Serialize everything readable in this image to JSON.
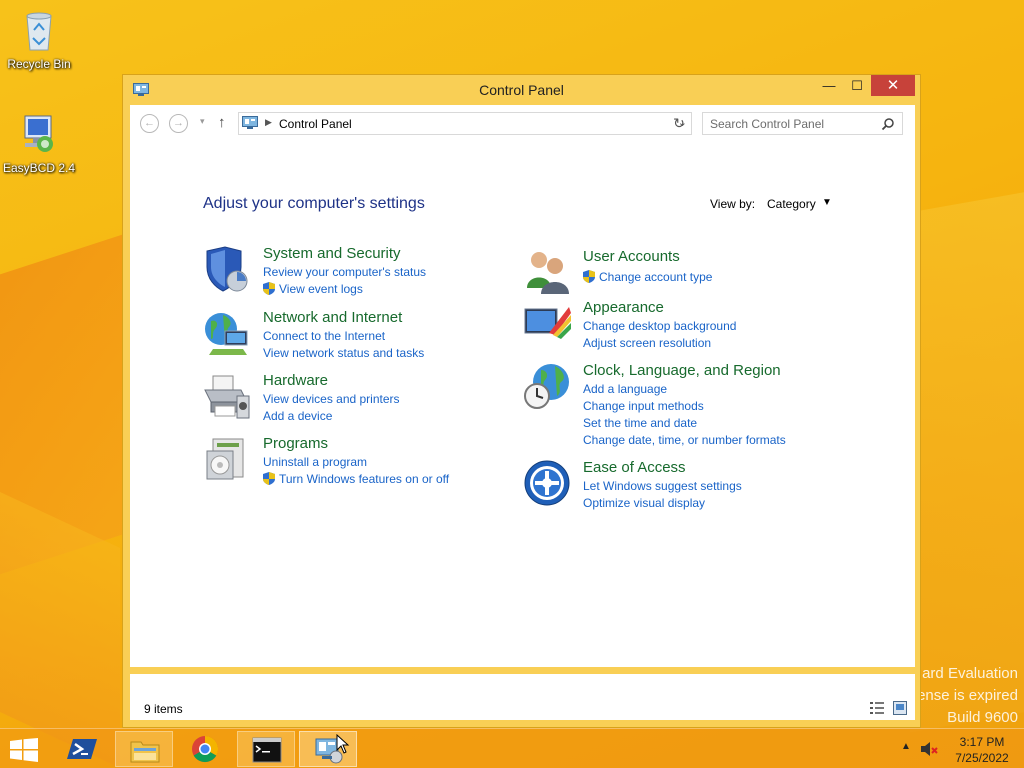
{
  "desktop": {
    "icons": [
      {
        "label": "Recycle Bin",
        "icon": "recycle-bin-icon"
      },
      {
        "label": "EasyBCD 2.4",
        "icon": "easybcd-icon"
      }
    ],
    "watermark": [
      "ard Evaluation",
      "ense is expired",
      "Build 9600"
    ]
  },
  "window": {
    "title": "Control Panel",
    "controls": {
      "minimize": "—",
      "maximize": "☐",
      "close": "✕"
    }
  },
  "nav": {
    "back_icon": "back-arrow-icon",
    "forward_icon": "forward-arrow-icon",
    "up_icon": "up-arrow-icon",
    "address": "Control Panel",
    "search_placeholder": "Search Control Panel"
  },
  "main": {
    "heading": "Adjust your computer's settings",
    "view_by_label": "View by:",
    "view_by_value": "Category",
    "categories_left": [
      {
        "title": "System and Security",
        "icon": "security-shield-icon",
        "links": [
          {
            "text": "Review your computer's status",
            "shield": false
          },
          {
            "text": "View event logs",
            "shield": true
          }
        ]
      },
      {
        "title": "Network and Internet",
        "icon": "network-globe-icon",
        "links": [
          {
            "text": "Connect to the Internet",
            "shield": false
          },
          {
            "text": "View network status and tasks",
            "shield": false
          }
        ]
      },
      {
        "title": "Hardware",
        "icon": "printer-icon",
        "links": [
          {
            "text": "View devices and printers",
            "shield": false
          },
          {
            "text": "Add a device",
            "shield": false
          }
        ]
      },
      {
        "title": "Programs",
        "icon": "programs-icon",
        "links": [
          {
            "text": "Uninstall a program",
            "shield": false
          },
          {
            "text": "Turn Windows features on or off",
            "shield": true
          }
        ]
      }
    ],
    "categories_right": [
      {
        "title": "User Accounts",
        "icon": "users-icon",
        "links": [
          {
            "text": "Change account type",
            "shield": true
          }
        ]
      },
      {
        "title": "Appearance",
        "icon": "appearance-icon",
        "links": [
          {
            "text": "Change desktop background",
            "shield": false
          },
          {
            "text": "Adjust screen resolution",
            "shield": false
          }
        ]
      },
      {
        "title": "Clock, Language, and Region",
        "icon": "clock-globe-icon",
        "links": [
          {
            "text": "Add a language",
            "shield": false
          },
          {
            "text": "Change input methods",
            "shield": false
          },
          {
            "text": "Set the time and date",
            "shield": false
          },
          {
            "text": "Change date, time, or number formats",
            "shield": false
          }
        ]
      },
      {
        "title": "Ease of Access",
        "icon": "ease-of-access-icon",
        "links": [
          {
            "text": "Let Windows suggest settings",
            "shield": false
          },
          {
            "text": "Optimize visual display",
            "shield": false
          }
        ]
      }
    ]
  },
  "status": {
    "items": "9 items"
  },
  "taskbar": {
    "buttons": [
      {
        "name": "start",
        "icon": "windows-logo-icon"
      },
      {
        "name": "powershell",
        "icon": "powershell-icon"
      },
      {
        "name": "file-explorer",
        "icon": "folder-icon"
      },
      {
        "name": "chrome",
        "icon": "chrome-icon"
      },
      {
        "name": "command-prompt",
        "icon": "cmd-icon"
      },
      {
        "name": "control-panel",
        "icon": "control-panel-icon"
      }
    ],
    "time": "3:17 PM",
    "date": "7/25/2022"
  },
  "colors": {
    "category_title": "#176a2d",
    "link": "#1a64c8",
    "heading": "#1e3287",
    "close_button": "#c7423a"
  }
}
